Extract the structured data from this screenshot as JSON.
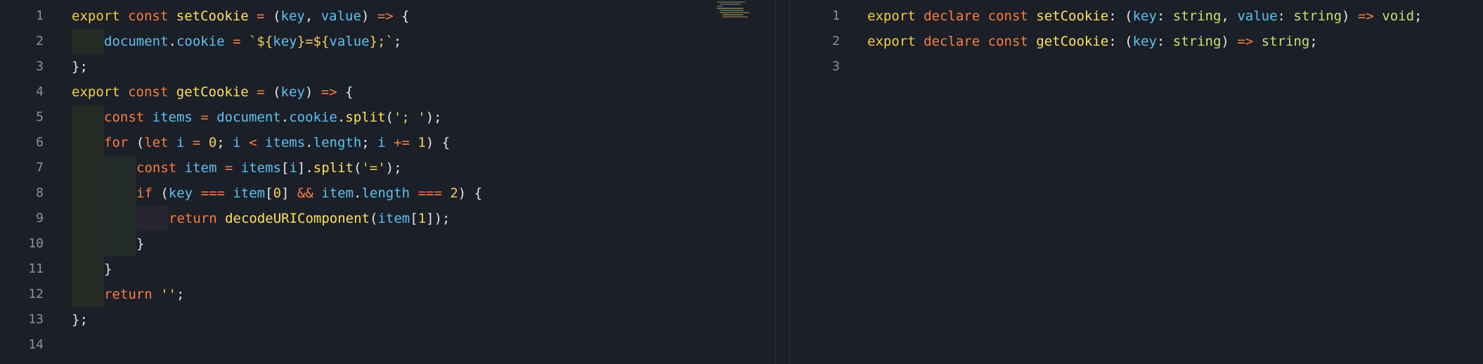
{
  "colors": {
    "background": "#1b1f28",
    "line_number": "#8b929e",
    "keyword": "#fe7d3c",
    "function": "#ffe25a",
    "variable": "#59c4f0",
    "string": "#f0d054",
    "type": "#c9e26b"
  },
  "left_editor": {
    "line_numbers": [
      "1",
      "2",
      "3",
      "4",
      "5",
      "6",
      "7",
      "8",
      "9",
      "10",
      "11",
      "12",
      "13",
      "14"
    ],
    "lines": [
      [
        [
          "kw2",
          "export"
        ],
        [
          "plain",
          " "
        ],
        [
          "kw",
          "const"
        ],
        [
          "plain",
          " "
        ],
        [
          "fn",
          "setCookie"
        ],
        [
          "plain",
          " "
        ],
        [
          "op",
          "="
        ],
        [
          "plain",
          " "
        ],
        [
          "pun",
          "("
        ],
        [
          "var",
          "key"
        ],
        [
          "pun",
          ", "
        ],
        [
          "var",
          "value"
        ],
        [
          "pun",
          ") "
        ],
        [
          "op",
          "=>"
        ],
        [
          "pun",
          " {"
        ]
      ],
      [
        [
          "var",
          "document"
        ],
        [
          "pun",
          "."
        ],
        [
          "var",
          "cookie"
        ],
        [
          "plain",
          " "
        ],
        [
          "op",
          "="
        ],
        [
          "plain",
          " "
        ],
        [
          "str",
          "`${"
        ],
        [
          "var",
          "key"
        ],
        [
          "str",
          "}=${"
        ],
        [
          "var",
          "value"
        ],
        [
          "str",
          "};`"
        ],
        [
          "pun",
          ";"
        ]
      ],
      [
        [
          "pun",
          "};"
        ]
      ],
      [
        [
          "kw2",
          "export"
        ],
        [
          "plain",
          " "
        ],
        [
          "kw",
          "const"
        ],
        [
          "plain",
          " "
        ],
        [
          "fn",
          "getCookie"
        ],
        [
          "plain",
          " "
        ],
        [
          "op",
          "="
        ],
        [
          "plain",
          " "
        ],
        [
          "pun",
          "("
        ],
        [
          "var",
          "key"
        ],
        [
          "pun",
          ") "
        ],
        [
          "op",
          "=>"
        ],
        [
          "pun",
          " {"
        ]
      ],
      [
        [
          "kw",
          "const"
        ],
        [
          "plain",
          " "
        ],
        [
          "var",
          "items"
        ],
        [
          "plain",
          " "
        ],
        [
          "op",
          "="
        ],
        [
          "plain",
          " "
        ],
        [
          "var",
          "document"
        ],
        [
          "pun",
          "."
        ],
        [
          "var",
          "cookie"
        ],
        [
          "pun",
          "."
        ],
        [
          "fn",
          "split"
        ],
        [
          "pun",
          "("
        ],
        [
          "str",
          "'; '"
        ],
        [
          "pun",
          ");"
        ]
      ],
      [
        [
          "kw",
          "for"
        ],
        [
          "pun",
          " ("
        ],
        [
          "kw",
          "let"
        ],
        [
          "plain",
          " "
        ],
        [
          "var",
          "i"
        ],
        [
          "plain",
          " "
        ],
        [
          "op",
          "="
        ],
        [
          "plain",
          " "
        ],
        [
          "num",
          "0"
        ],
        [
          "pun",
          "; "
        ],
        [
          "var",
          "i"
        ],
        [
          "plain",
          " "
        ],
        [
          "op",
          "<"
        ],
        [
          "plain",
          " "
        ],
        [
          "var",
          "items"
        ],
        [
          "pun",
          "."
        ],
        [
          "var",
          "length"
        ],
        [
          "pun",
          "; "
        ],
        [
          "var",
          "i"
        ],
        [
          "plain",
          " "
        ],
        [
          "op",
          "+="
        ],
        [
          "plain",
          " "
        ],
        [
          "num",
          "1"
        ],
        [
          "pun",
          ") {"
        ]
      ],
      [
        [
          "kw",
          "const"
        ],
        [
          "plain",
          " "
        ],
        [
          "var",
          "item"
        ],
        [
          "plain",
          " "
        ],
        [
          "op",
          "="
        ],
        [
          "plain",
          " "
        ],
        [
          "var",
          "items"
        ],
        [
          "pun",
          "["
        ],
        [
          "var",
          "i"
        ],
        [
          "pun",
          "]."
        ],
        [
          "fn",
          "split"
        ],
        [
          "pun",
          "("
        ],
        [
          "str",
          "'='"
        ],
        [
          "pun",
          ");"
        ]
      ],
      [
        [
          "kw",
          "if"
        ],
        [
          "pun",
          " ("
        ],
        [
          "var",
          "key"
        ],
        [
          "plain",
          " "
        ],
        [
          "op",
          "==="
        ],
        [
          "plain",
          " "
        ],
        [
          "var",
          "item"
        ],
        [
          "pun",
          "["
        ],
        [
          "num",
          "0"
        ],
        [
          "pun",
          "] "
        ],
        [
          "op",
          "&&"
        ],
        [
          "plain",
          " "
        ],
        [
          "var",
          "item"
        ],
        [
          "pun",
          "."
        ],
        [
          "var",
          "length"
        ],
        [
          "plain",
          " "
        ],
        [
          "op",
          "==="
        ],
        [
          "plain",
          " "
        ],
        [
          "num",
          "2"
        ],
        [
          "pun",
          ") {"
        ]
      ],
      [
        [
          "kw",
          "return"
        ],
        [
          "plain",
          " "
        ],
        [
          "fn",
          "decodeURIComponent"
        ],
        [
          "pun",
          "("
        ],
        [
          "var",
          "item"
        ],
        [
          "pun",
          "["
        ],
        [
          "num",
          "1"
        ],
        [
          "pun",
          "]);"
        ]
      ],
      [
        [
          "pun",
          "}"
        ]
      ],
      [
        [
          "pun",
          "}"
        ]
      ],
      [
        [
          "kw",
          "return"
        ],
        [
          "plain",
          " "
        ],
        [
          "str",
          "''"
        ],
        [
          "pun",
          ";"
        ]
      ],
      [
        [
          "pun",
          "};"
        ]
      ],
      []
    ]
  },
  "right_editor": {
    "line_numbers": [
      "1",
      "2",
      "3"
    ],
    "lines": [
      [
        [
          "kw2",
          "export"
        ],
        [
          "plain",
          " "
        ],
        [
          "kw",
          "declare"
        ],
        [
          "plain",
          " "
        ],
        [
          "kw",
          "const"
        ],
        [
          "plain",
          " "
        ],
        [
          "fn",
          "setCookie"
        ],
        [
          "pun",
          ": ("
        ],
        [
          "var",
          "key"
        ],
        [
          "pun",
          ": "
        ],
        [
          "typ",
          "string"
        ],
        [
          "pun",
          ", "
        ],
        [
          "var",
          "value"
        ],
        [
          "pun",
          ": "
        ],
        [
          "typ",
          "string"
        ],
        [
          "pun",
          ") "
        ],
        [
          "op",
          "=>"
        ],
        [
          "plain",
          " "
        ],
        [
          "typ",
          "void"
        ],
        [
          "pun",
          ";"
        ]
      ],
      [
        [
          "kw2",
          "export"
        ],
        [
          "plain",
          " "
        ],
        [
          "kw",
          "declare"
        ],
        [
          "plain",
          " "
        ],
        [
          "kw",
          "const"
        ],
        [
          "plain",
          " "
        ],
        [
          "fn",
          "getCookie"
        ],
        [
          "pun",
          ": ("
        ],
        [
          "var",
          "key"
        ],
        [
          "pun",
          ": "
        ],
        [
          "typ",
          "string"
        ],
        [
          "pun",
          ") "
        ],
        [
          "op",
          "=>"
        ],
        [
          "plain",
          " "
        ],
        [
          "typ",
          "string"
        ],
        [
          "pun",
          ";"
        ]
      ],
      []
    ]
  }
}
